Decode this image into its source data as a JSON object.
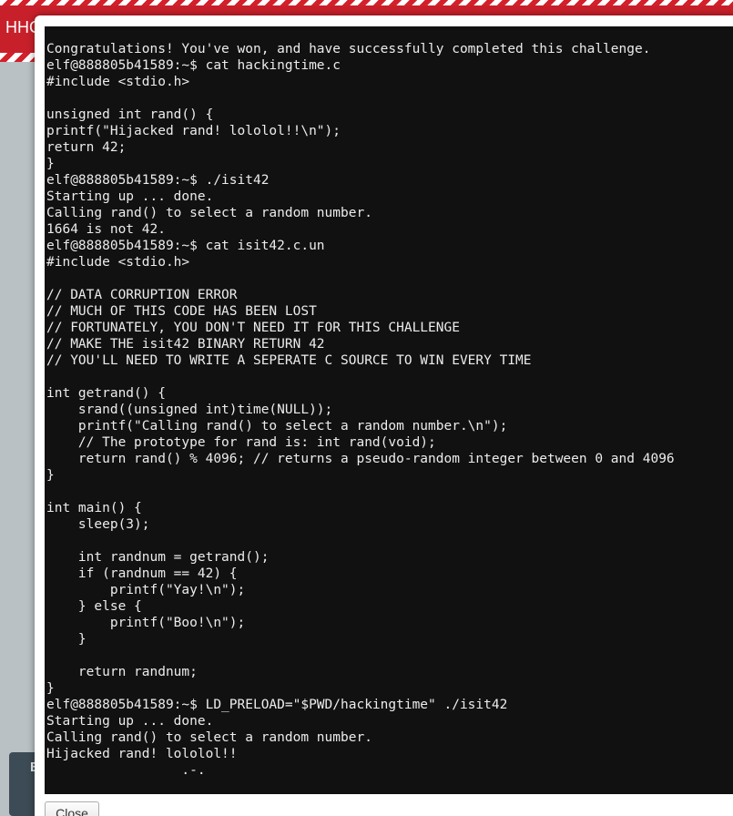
{
  "banner": {
    "title": "HHC"
  },
  "background": {
    "panel_label": "B"
  },
  "terminal": {
    "lines": [
      "Congratulations! You've won, and have successfully completed this challenge.",
      "elf@888805b41589:~$ cat hackingtime.c",
      "#include <stdio.h>",
      "",
      "unsigned int rand() {",
      "printf(\"Hijacked rand! lololol!!\\n\");",
      "return 42;",
      "}",
      "elf@888805b41589:~$ ./isit42",
      "Starting up ... done.",
      "Calling rand() to select a random number.",
      "1664 is not 42.",
      "elf@888805b41589:~$ cat isit42.c.un",
      "#include <stdio.h>",
      "",
      "// DATA CORRUPTION ERROR",
      "// MUCH OF THIS CODE HAS BEEN LOST",
      "// FORTUNATELY, YOU DON'T NEED IT FOR THIS CHALLENGE",
      "// MAKE THE isit42 BINARY RETURN 42",
      "// YOU'LL NEED TO WRITE A SEPERATE C SOURCE TO WIN EVERY TIME",
      "",
      "int getrand() {",
      "    srand((unsigned int)time(NULL));",
      "    printf(\"Calling rand() to select a random number.\\n\");",
      "    // The prototype for rand is: int rand(void);",
      "    return rand() % 4096; // returns a pseudo-random integer between 0 and 4096",
      "}",
      "",
      "int main() {",
      "    sleep(3);",
      "",
      "    int randnum = getrand();",
      "    if (randnum == 42) {",
      "        printf(\"Yay!\\n\");",
      "    } else {",
      "        printf(\"Boo!\\n\");",
      "    }",
      "",
      "    return randnum;",
      "}",
      "elf@888805b41589:~$ LD_PRELOAD=\"$PWD/hackingtime\" ./isit42",
      "Starting up ... done.",
      "Calling rand() to select a random number.",
      "Hijacked rand! lololol!!",
      "                 .-."
    ]
  },
  "modal": {
    "close_label": "Close"
  },
  "colors": {
    "banner_red": "#c8202a",
    "terminal_bg": "#111111",
    "terminal_fg": "#ececec"
  }
}
